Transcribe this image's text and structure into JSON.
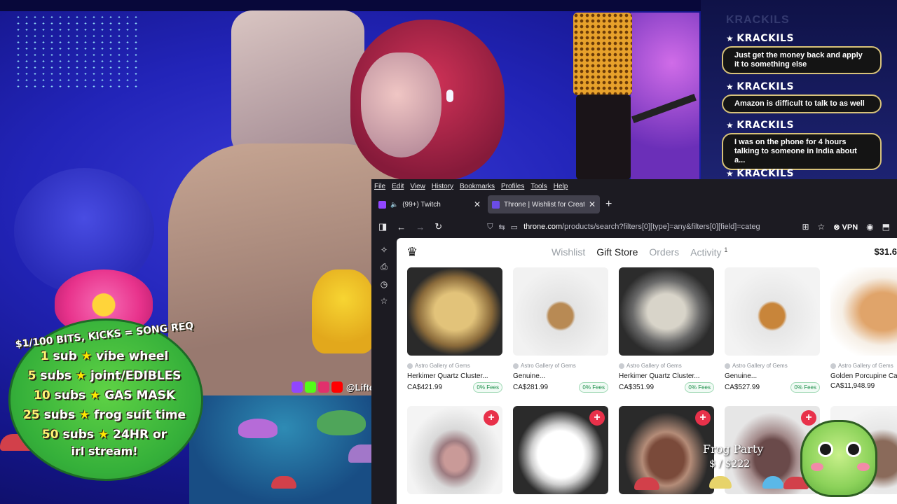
{
  "chat": {
    "messages": [
      {
        "user": "KRACKILS",
        "text": "Just get the money back and apply it to something else"
      },
      {
        "user": "KRACKILS",
        "text": "Amazon is difficult to talk to as well"
      },
      {
        "user": "KRACKILS",
        "text": "I was on the phone for 4 hours talking to someone in India about a..."
      },
      {
        "user": "KRACKILS",
        "text": ""
      }
    ]
  },
  "alerts": {
    "header": "$1/100 BITS, KICKS = SONG REQ",
    "tiers": [
      {
        "count": "1",
        "unit": "sub",
        "reward": "vibe wheel"
      },
      {
        "count": "5",
        "unit": "subs",
        "reward": "joint/EDIBLES"
      },
      {
        "count": "10",
        "unit": "subs",
        "reward": "GAS MASK"
      },
      {
        "count": "25",
        "unit": "subs",
        "reward": "frog suit time"
      },
      {
        "count": "50",
        "unit": "subs",
        "reward": "24HR or"
      }
    ],
    "tail": "irl stream!",
    "star": "★"
  },
  "social": {
    "handle": "@LiftedVibes"
  },
  "overlay": {
    "party_title": "Frog Party",
    "party_amount": "$  / $222"
  },
  "browser": {
    "menu": [
      "File",
      "Edit",
      "View",
      "History",
      "Bookmarks",
      "Profiles",
      "Tools",
      "Help"
    ],
    "tabs": [
      {
        "title": "(99+) Twitch",
        "active": false
      },
      {
        "title": "Throne | Wishlist for Creators -",
        "active": true
      }
    ],
    "url_host": "throne.com",
    "url_path": "/products/search?filters[0][type]=any&filters[0][field]=categ",
    "vpn_label": "VPN",
    "colors": {
      "add_button": "#e8314a",
      "fees_text": "#1d8f4a",
      "accent": "#6b4ce6"
    }
  },
  "store": {
    "nav": [
      {
        "label": "Wishlist",
        "active": false
      },
      {
        "label": "Gift Store",
        "active": true
      },
      {
        "label": "Orders",
        "active": false
      },
      {
        "label": "Activity",
        "active": false,
        "badge": "1"
      }
    ],
    "balance": "$31.6",
    "products": [
      {
        "shop": "Astro Gallery of Gems",
        "title": "Herkimer Quartz Cluster...",
        "price": "CA$421.99",
        "fees": "0% Fees"
      },
      {
        "shop": "Astro Gallery of Gems",
        "title": "Genuine...",
        "price": "CA$281.99",
        "fees": "0% Fees"
      },
      {
        "shop": "Astro Gallery of Gems",
        "title": "Herkimer Quartz Cluster...",
        "price": "CA$351.99",
        "fees": "0% Fees"
      },
      {
        "shop": "Astro Gallery of Gems",
        "title": "Genuine...",
        "price": "CA$527.99",
        "fees": "0% Fees"
      },
      {
        "shop": "Astro Gallery of Gems",
        "title": "Golden Porcupine Ca",
        "price": "CA$11,948.99",
        "fees": ""
      }
    ],
    "add_symbol": "+"
  }
}
